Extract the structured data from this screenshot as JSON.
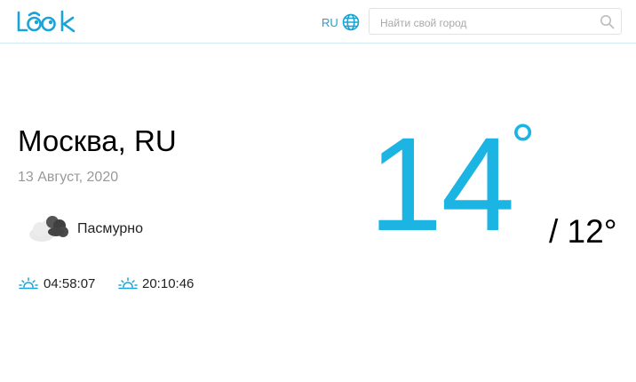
{
  "header": {
    "logo_text": "LOOK",
    "language": "RU",
    "search_placeholder": "Найти свой город"
  },
  "weather": {
    "city": "Москва, RU",
    "date": "13 Август, 2020",
    "condition": "Пасмурно",
    "sunrise": "04:58:07",
    "sunset": "20:10:46",
    "temp_current": "14",
    "temp_degree": "°",
    "temp_min": "/ 12°"
  },
  "colors": {
    "accent": "#1aa3d6",
    "temp": "#1bb4e3",
    "muted": "#999999"
  },
  "icons": {
    "language": "globe-icon",
    "search": "search-icon",
    "condition": "overcast-cloud-icon",
    "sunrise": "sunrise-icon",
    "sunset": "sunset-icon"
  }
}
